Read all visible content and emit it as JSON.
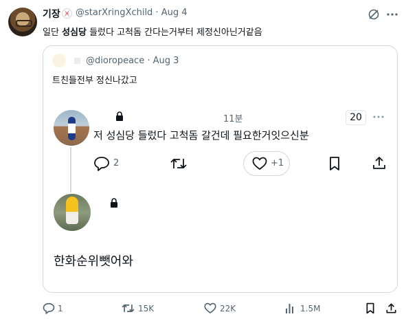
{
  "tweet": {
    "display_name": "기장",
    "handle_time": "@starXringXchild · Aug 4",
    "text_prefix": "일단 ",
    "text_bold": "성심당",
    "text_suffix": " 들렀다 고척돔 간다는거부터 제정신아닌거같음"
  },
  "quote": {
    "handle_time": "@dioropeace · Aug 3",
    "text": "트친들전부 정신나갔고"
  },
  "embedded_screenshot": {
    "time": "11분",
    "badge": "20",
    "text": "저 성심당 들렀다 고척돔 갈건데 필요한거잇으신분",
    "reply_count": "2",
    "like_count": "+1",
    "reply_text": "한화순위뺏어와"
  },
  "actions": {
    "replies": "1",
    "reposts": "15K",
    "likes": "22K",
    "views": "1.5M"
  },
  "colors": {
    "text": "#0f1419",
    "secondary": "#536471",
    "border": "#cfd9de"
  },
  "icons": [
    "grok-icon",
    "more-icon",
    "lock-icon",
    "reply-icon",
    "retweet-icon",
    "like-icon",
    "views-icon",
    "bookmark-icon",
    "share-icon"
  ]
}
